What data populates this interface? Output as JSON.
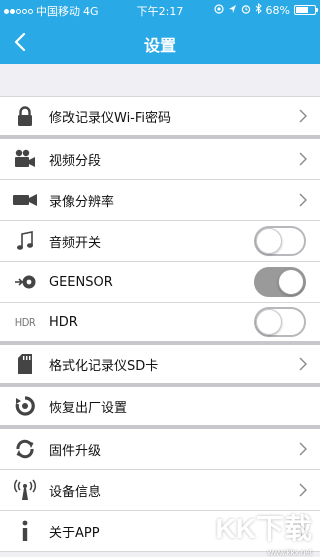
{
  "status_bar": {
    "carrier": "中国移动",
    "network": "4G",
    "time": "下午2:17",
    "battery": "68%",
    "battery_level": 0.68
  },
  "nav": {
    "title": "设置"
  },
  "settings": {
    "wifi_password": "修改记录仪Wi-Fi密码",
    "video_segment": "视频分段",
    "resolution": "录像分辨率",
    "audio_switch": "音频开关",
    "geensor": "GEENSOR",
    "hdr_icon_text": "HDR",
    "hdr": "HDR",
    "format_sd": "格式化记录仪SD卡",
    "factory_reset": "恢复出厂设置",
    "firmware_upgrade": "固件升级",
    "device_info": "设备信息",
    "about_app": "关于APP"
  },
  "toggles": {
    "audio_switch_on": false,
    "geensor_on": true,
    "hdr_on": false
  },
  "watermark": {
    "logo": "KK下载",
    "url": "www.kkx.net"
  },
  "colors": {
    "header": "#29a9e6",
    "toggle_on": "#9a9a9a"
  }
}
